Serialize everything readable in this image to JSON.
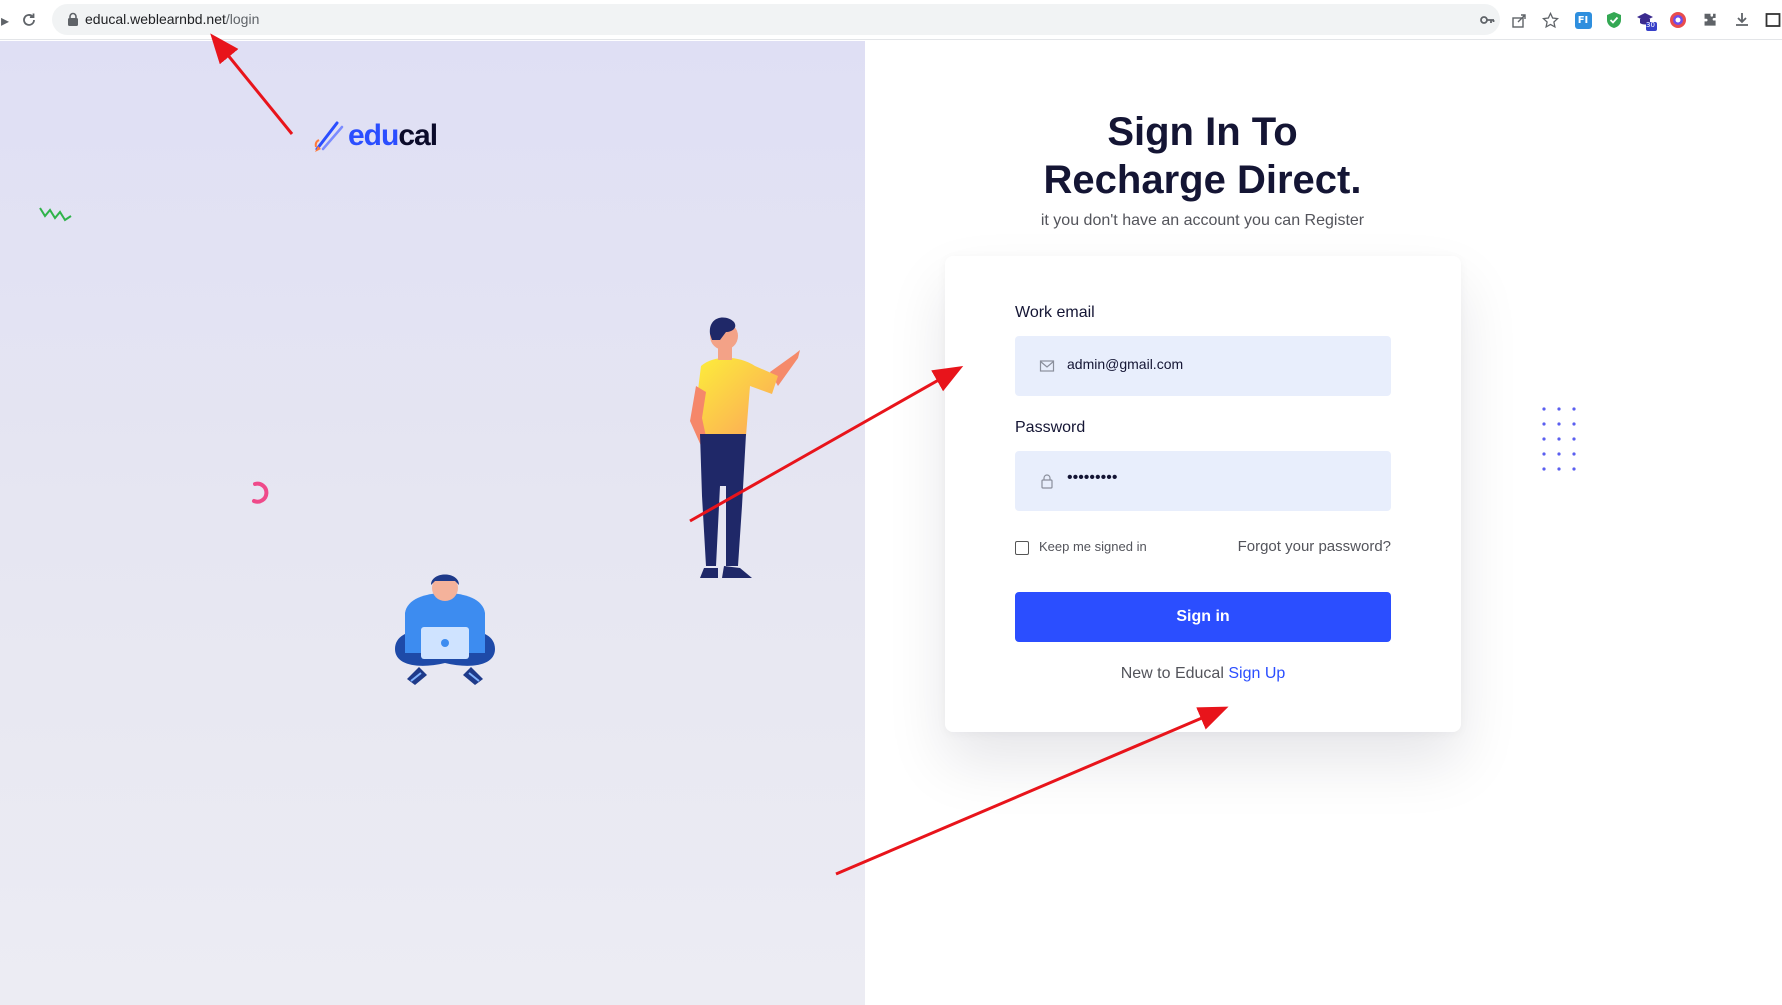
{
  "browser": {
    "url_host": "educal.weblearnbd.net",
    "url_path": "/login",
    "icons": [
      "reload-icon",
      "lock-icon",
      "key-icon",
      "share-icon",
      "bookmark-star-icon",
      "extension-fi-icon",
      "extension-shield-icon",
      "extension-cap-icon",
      "extension-color-icon",
      "puzzle-icon",
      "download-icon",
      "sidepanel-icon"
    ],
    "badge_count": "30"
  },
  "brand": {
    "logo_part1": "edu",
    "logo_part2": "cal",
    "colors": {
      "primary": "#2b4eff",
      "dark": "#141534",
      "field_bg": "#e8eefc"
    }
  },
  "header": {
    "title_line1": "Sign In To",
    "title_line2": "Recharge Direct.",
    "subtitle": "it you don't have an account you can Register"
  },
  "form": {
    "email_label": "Work email",
    "email_value": "admin@gmail.com",
    "email_icon": "mail-icon",
    "password_label": "Password",
    "password_value": "•••••••••",
    "password_icon": "lock-icon",
    "keep_signed_in_label": "Keep me signed in",
    "keep_signed_in_checked": false,
    "forgot_label": "Forgot your password?",
    "submit_label": "Sign in",
    "new_to_text": "New to Educal",
    "signup_label": "Sign Up"
  }
}
